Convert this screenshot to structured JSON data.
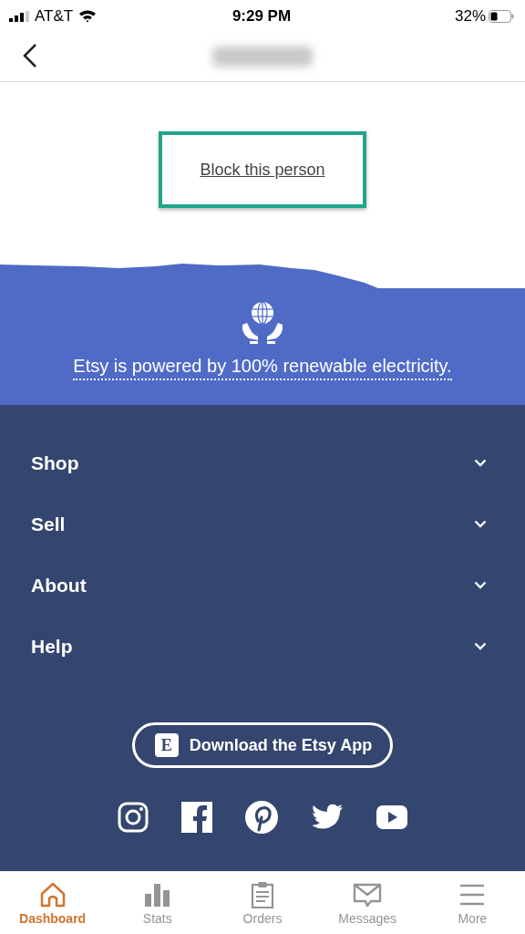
{
  "status_bar": {
    "carrier": "AT&T",
    "time": "9:29 PM",
    "battery": "32%"
  },
  "block_link": {
    "label": "Block this person",
    "highlighted": true
  },
  "banner": {
    "text": "Etsy is powered by 100% renewable electricity."
  },
  "footer_sections": [
    {
      "label": "Shop",
      "expanded": false
    },
    {
      "label": "Sell",
      "expanded": false
    },
    {
      "label": "About",
      "expanded": false
    },
    {
      "label": "Help",
      "expanded": false
    }
  ],
  "download_button": {
    "badge": "E",
    "label": "Download the Etsy App"
  },
  "tab_bar": [
    {
      "label": "Dashboard",
      "selected": true
    },
    {
      "label": "Stats",
      "selected": false
    },
    {
      "label": "Orders",
      "selected": false
    },
    {
      "label": "Messages",
      "selected": false
    },
    {
      "label": "More",
      "selected": false
    }
  ]
}
